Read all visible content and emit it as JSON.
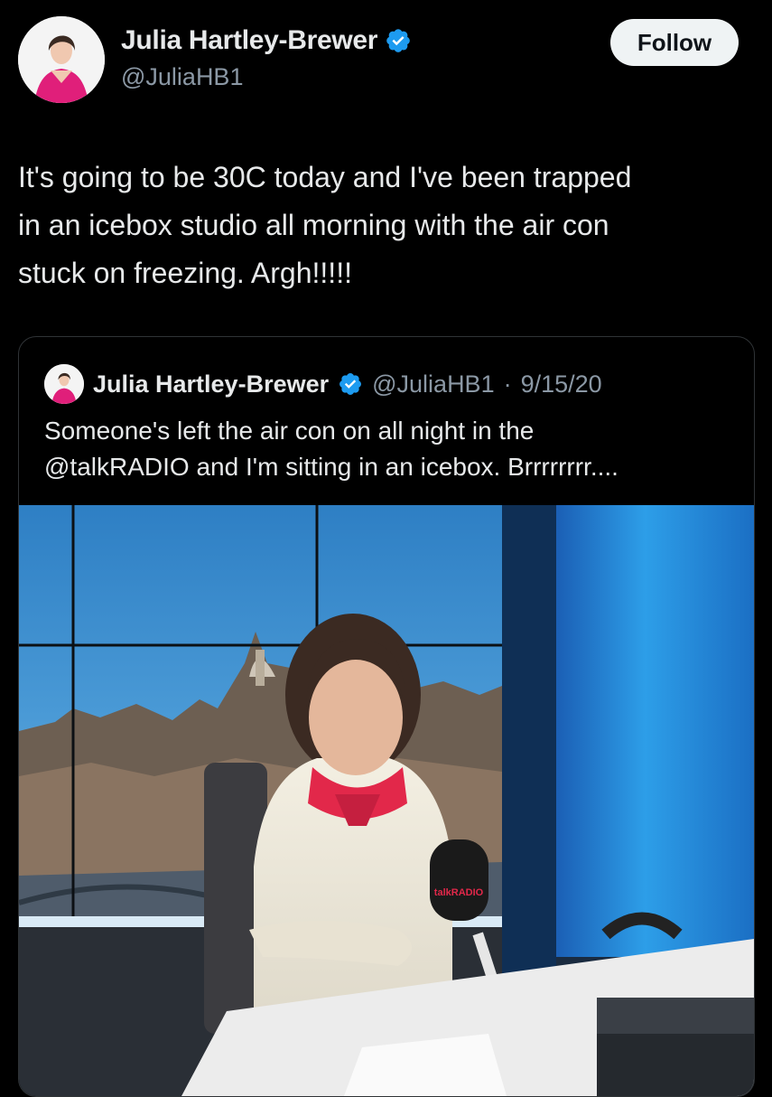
{
  "tweet": {
    "author_name": "Julia Hartley-Brewer",
    "handle": "@JuliaHB1",
    "follow_label": "Follow",
    "text": "It's going to be 30C today and I've been trapped\nin an icebox studio all morning with the air con\nstuck on freezing. Argh!!!!!"
  },
  "quote": {
    "author_name": "Julia Hartley-Brewer",
    "handle": "@JuliaHB1",
    "separator": "·",
    "date": "9/15/20",
    "text": "Someone's left the air con on all night in the\n@talkRADIO and I'm sitting in an icebox. Brrrrrrrr....",
    "mic_brand": "talkRADIO"
  },
  "colors": {
    "background": "#000000",
    "text_primary": "#e7e9ea",
    "text_secondary": "#8b98a5",
    "verified_blue": "#1d9bf0",
    "follow_bg": "#eff3f4",
    "card_border": "#2f3336"
  },
  "icons": {
    "verified": "verified-badge-icon"
  }
}
